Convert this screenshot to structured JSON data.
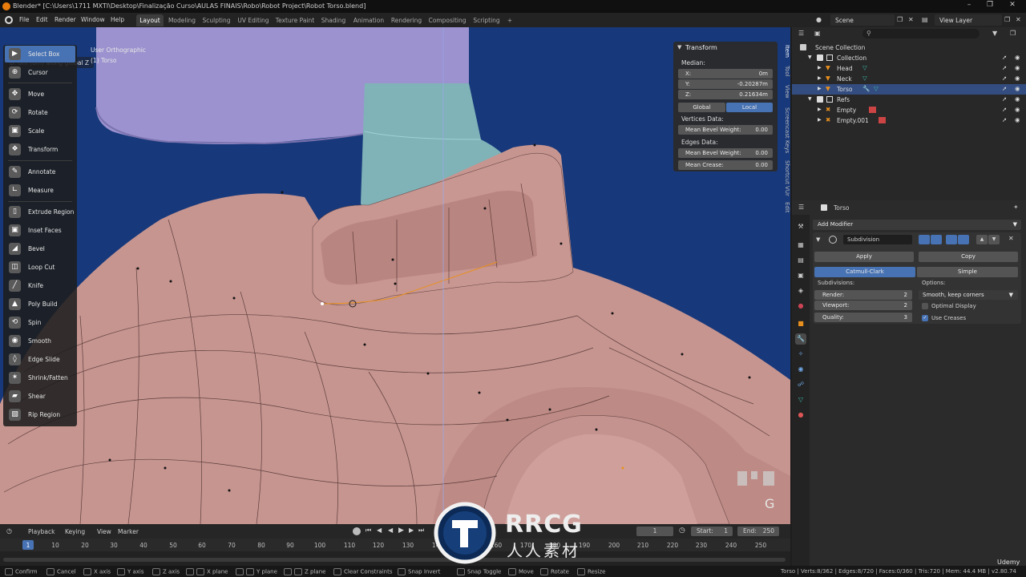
{
  "titlebar": {
    "title": "Blender* [C:\\Users\\1711 MXTI\\Desktop\\Finalização Curso\\AULAS FINAIS\\Robo\\Robot Project\\Robot Torso.blend]"
  },
  "menu": [
    "File",
    "Edit",
    "Render",
    "Window",
    "Help"
  ],
  "workspaces": [
    "Layout",
    "Modeling",
    "Sculpting",
    "UV Editing",
    "Texture Paint",
    "Shading",
    "Animation",
    "Rendering",
    "Compositing",
    "Scripting"
  ],
  "header": {
    "scene": "Scene",
    "view_layer": "View Layer"
  },
  "viewport": {
    "operator_text": "D: 0m (0m) along global Z",
    "view_name": "User Orthographic",
    "object_name": "(1) Torso",
    "key_hint": "G"
  },
  "toolbar": [
    {
      "label": "Select Box",
      "icon": "select-box-icon"
    },
    {
      "label": "Cursor",
      "icon": "cursor-icon"
    },
    {
      "label": "Move",
      "icon": "move-icon"
    },
    {
      "label": "Rotate",
      "icon": "rotate-icon"
    },
    {
      "label": "Scale",
      "icon": "scale-icon"
    },
    {
      "label": "Transform",
      "icon": "transform-icon"
    },
    {
      "label": "Annotate",
      "icon": "annotate-icon"
    },
    {
      "label": "Measure",
      "icon": "measure-icon"
    },
    {
      "label": "Extrude Region",
      "icon": "extrude-region-icon"
    },
    {
      "label": "Inset Faces",
      "icon": "inset-faces-icon"
    },
    {
      "label": "Bevel",
      "icon": "bevel-icon"
    },
    {
      "label": "Loop Cut",
      "icon": "loop-cut-icon"
    },
    {
      "label": "Knife",
      "icon": "knife-icon"
    },
    {
      "label": "Poly Build",
      "icon": "poly-build-icon"
    },
    {
      "label": "Spin",
      "icon": "spin-icon"
    },
    {
      "label": "Smooth",
      "icon": "smooth-icon"
    },
    {
      "label": "Edge Slide",
      "icon": "edge-slide-icon"
    },
    {
      "label": "Shrink/Fatten",
      "icon": "shrink-fatten-icon"
    },
    {
      "label": "Shear",
      "icon": "shear-icon"
    },
    {
      "label": "Rip Region",
      "icon": "rip-region-icon"
    }
  ],
  "transform_panel": {
    "title": "Transform",
    "median_label": "Median:",
    "x_label": "X:",
    "x_value": "0m",
    "y_label": "Y:",
    "y_value": "-0.20287m",
    "z_label": "Z:",
    "z_value": "0.21634m",
    "global_label": "Global",
    "local_label": "Local",
    "vertices_data_label": "Vertices Data:",
    "mean_bevel_weight_label": "Mean Bevel Weight:",
    "vertex_bevel_weight": "0.00",
    "edges_data_label": "Edges Data:",
    "edge_bevel_weight": "0.00",
    "mean_crease_label": "Mean Crease:",
    "mean_crease": "0.00"
  },
  "npanel_tabs": [
    "Item",
    "Tool",
    "View",
    "Screencast Keys",
    "Shortcut VUr",
    "Edit"
  ],
  "outliner": {
    "rows": [
      {
        "label": "Scene Collection"
      },
      {
        "label": "Collection"
      },
      {
        "label": "Head"
      },
      {
        "label": "Neck"
      },
      {
        "label": "Torso"
      },
      {
        "label": "Refs"
      },
      {
        "label": "Empty"
      },
      {
        "label": "Empty.001"
      }
    ]
  },
  "properties": {
    "object_name": "Torso",
    "add_modifier": "Add Modifier",
    "modifier_name": "Subdivision",
    "apply": "Apply",
    "copy": "Copy",
    "catmull_clark": "Catmull-Clark",
    "simple": "Simple",
    "subdivisions_label": "Subdivisions:",
    "render_label": "Render:",
    "render_value": "2",
    "viewport_label": "Viewport:",
    "viewport_value": "2",
    "quality_label": "Quality:",
    "quality_value": "3",
    "options_label": "Options:",
    "uv_smooth": "Smooth, keep corners",
    "optimal_display": "Optimal Display",
    "use_creases": "Use Creases"
  },
  "timeline": {
    "playback": "Playback",
    "keying": "Keying",
    "view": "View",
    "marker": "Marker",
    "current_frame": "1",
    "start_label": "Start:",
    "start": "1",
    "end_label": "End:",
    "end": "250",
    "frames": [
      "1",
      "10",
      "20",
      "30",
      "40",
      "50",
      "60",
      "70",
      "80",
      "90",
      "100",
      "110",
      "120",
      "130",
      "140",
      "150",
      "160",
      "170",
      "180",
      "190",
      "200",
      "210",
      "220",
      "230",
      "240",
      "250"
    ]
  },
  "statusbar": {
    "items": [
      "Confirm",
      "Cancel",
      "X axis",
      "Y axis",
      "Z axis",
      "X plane",
      "Y plane",
      "Z plane",
      "Clear Constraints",
      "Snap Invert",
      "Snap Toggle",
      "Move",
      "Rotate",
      "Resize"
    ],
    "stats": "Torso | Verts:8/362 | Edges:8/720 | Faces:0/360 | Tris:720 | Mem: 44.4 MB | v2.80.74"
  },
  "watermark": {
    "brand": "RRCG",
    "sub": "人人素材",
    "udemy": "Udemy"
  },
  "colors": {
    "viewport_bg": "#17387a",
    "mesh": "#c69590",
    "selection": "#4772b3",
    "neck": "#7fb3b8",
    "head": "#9b92cf"
  }
}
